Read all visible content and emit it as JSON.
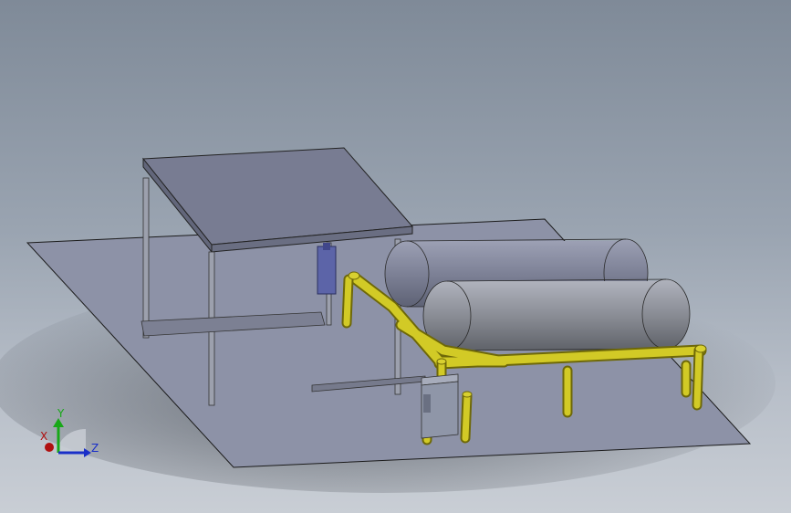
{
  "viewport": {
    "background_top": "#7f8a98",
    "background_bottom": "#c9ced5"
  },
  "model": {
    "floor_color": "#8d92a7",
    "table_color": "#787c92",
    "tank_color": "#7c8096",
    "pipe_color": "#c9c21c",
    "box_color": "#8f96a8",
    "actuator_color": "#5c64a8"
  },
  "triad": {
    "x_label": "X",
    "y_label": "Y",
    "z_label": "Z",
    "x_color": "#b01010",
    "y_color": "#18a818",
    "z_color": "#1a2fc8"
  }
}
